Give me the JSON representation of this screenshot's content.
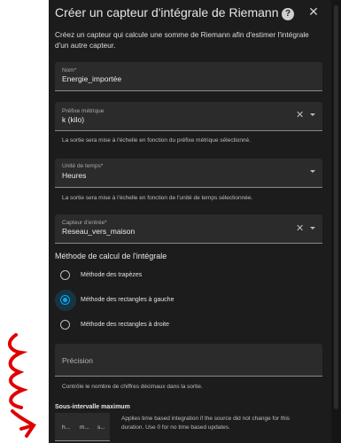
{
  "dialog": {
    "title": "Créer un capteur d'intégrale de Riemann",
    "description": "Créez un capteur qui calcule une somme de Riemann afin d'estimer l'intégrale d'un autre capteur.",
    "help_icon": "help-circle-icon",
    "close_icon": "close-icon"
  },
  "fields": {
    "name": {
      "label": "Nom*",
      "value": "Energie_importée"
    },
    "metric_prefix": {
      "label": "Préfixe métrique",
      "value": "k (kilo)",
      "helper": "La sortie sera mise à l'échelle en fonction du préfixe métrique sélectionné."
    },
    "time_unit": {
      "label": "Unité de temps*",
      "value": "Heures",
      "helper": "La sortie sera mise à l'échelle en fonction de l'unité de temps sélectionnée."
    },
    "input_sensor": {
      "label": "Capteur d'entrée*",
      "value": "Reseau_vers_maison"
    }
  },
  "method": {
    "title": "Méthode de calcul de l'intégrale",
    "options": [
      {
        "label": "Méthode des trapèzes",
        "checked": false
      },
      {
        "label": "Méthode des rectangles à gauche",
        "checked": true
      },
      {
        "label": "Méthode des rectangles à droite",
        "checked": false
      }
    ]
  },
  "precision": {
    "placeholder": "Précision",
    "helper": "Contrôle le nombre de chiffres décimaux dans la sortie."
  },
  "sub_interval": {
    "title": "Sous-intervalle maximum",
    "hours": "h...",
    "minutes": "m...",
    "seconds": "s...",
    "helper": "Applies time based integration if the source did not change for this duration. Use 0 for no time based updates."
  },
  "colors": {
    "accent": "#03a9f4",
    "dialog_bg": "#1c1c1c",
    "field_bg": "#2b2b2b",
    "annotation": "#e00000"
  }
}
